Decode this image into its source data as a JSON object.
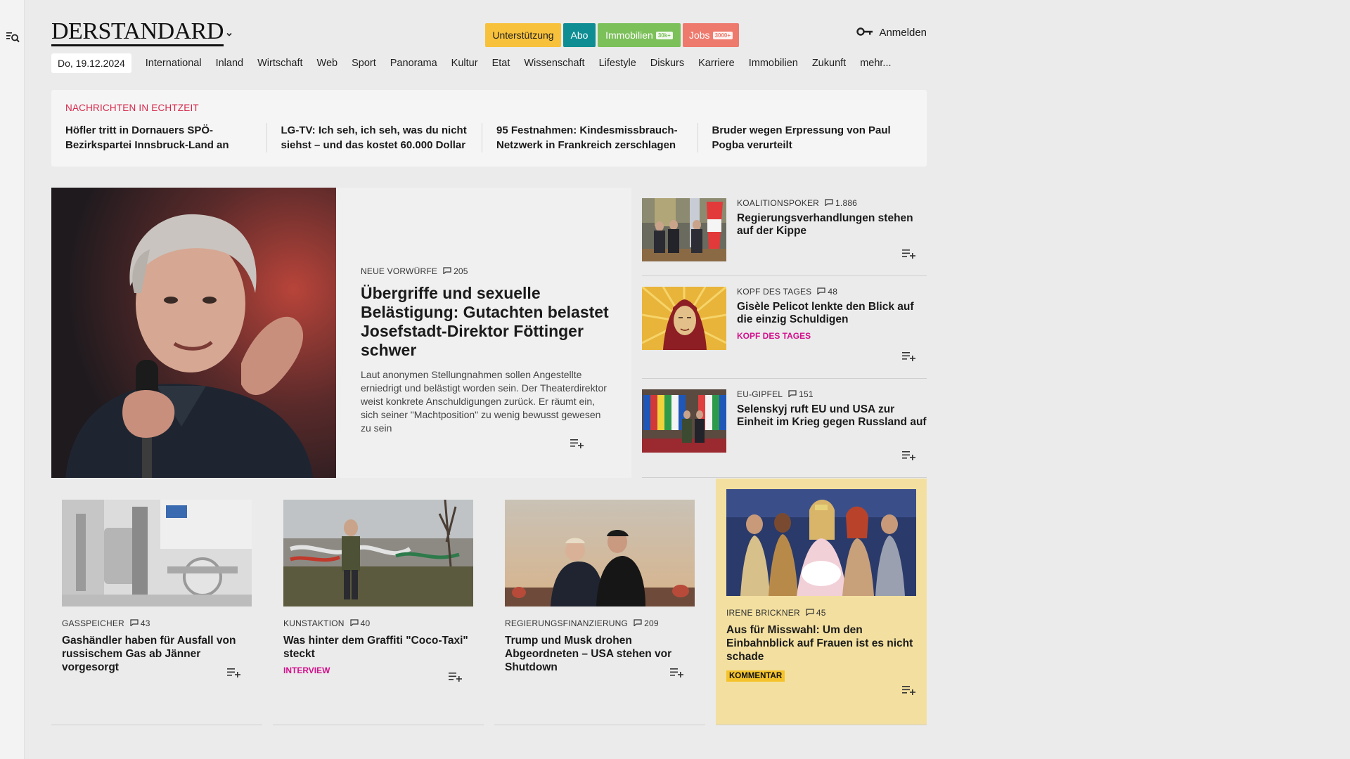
{
  "header": {
    "logo": "DERSTANDARD",
    "promos": {
      "unterstuetzung": "Unterstützung",
      "abo": "Abo",
      "immobilien": "Immobilien",
      "immobilien_badge": "30k+",
      "jobs": "Jobs",
      "jobs_badge": "3000+"
    },
    "login": "Anmelden"
  },
  "nav": {
    "date": "Do, 19.12.2024",
    "items": [
      "International",
      "Inland",
      "Wirtschaft",
      "Web",
      "Sport",
      "Panorama",
      "Kultur",
      "Etat",
      "Wissenschaft",
      "Lifestyle",
      "Diskurs",
      "Karriere",
      "Immobilien",
      "Zukunft",
      "mehr..."
    ]
  },
  "ticker": {
    "label": "Nachrichten in Echtzeit",
    "items": [
      "Höfler tritt in Dornauers SPÖ-Bezirks­partei Innsbruck-Land an",
      "LG-TV: Ich seh, ich seh, was du nicht siehst – und das kostet 60.000 Dollar",
      "95 Festnahmen: Kindesmissbrauch-Netzwerk in Frankreich zerschlagen",
      "Bruder wegen Erpressung von Paul Pogba verurteilt"
    ]
  },
  "hero": {
    "kicker": "Neue Vorwürfe",
    "comments": "205",
    "title": "Übergriffe und sexuelle Belästigung: Gutachten belastet Josefstadt-Direktor Föttinger schwer",
    "teaser": "Laut anonymen Stellungnahmen sollen Angestellte erniedrigt und belästigt worden sein. Der Theaterdi­rektor weist konkrete Anschuldigungen zurück. Er räumt ein, sich seiner \"Machtposition\" zu wenig bewusst gewesen zu sein"
  },
  "side": [
    {
      "kicker": "Koalitionspoker",
      "comments": "1.886",
      "title": "Regierungsverhandlungen stehen auf der Kippe",
      "tag": ""
    },
    {
      "kicker": "Kopf des Tages",
      "comments": "48",
      "title": "Gisèle Pelicot lenkte den Blick auf die einzig Schuldigen",
      "tag": "Kopf des Tages"
    },
    {
      "kicker": "EU-Gipfel",
      "comments": "151",
      "title": "Selenskyj ruft EU und USA zur Einheit im Krieg gegen Russland auf",
      "tag": ""
    }
  ],
  "cards": [
    {
      "kicker": "Gasspeicher",
      "comments": "43",
      "title": "Gashändler haben für Ausfall von russischem Gas ab Jänner vorgesorgt",
      "tag": ""
    },
    {
      "kicker": "Kunstaktion",
      "comments": "40",
      "title": "Was hinter dem Graffiti \"Coco-Taxi\" steckt",
      "tag": "Interview"
    },
    {
      "kicker": "Regierungsfinanzierung",
      "comments": "209",
      "title": "Trump und Musk drohen Abgeordneten – USA stehen vor Shutdown",
      "tag": ""
    },
    {
      "kicker": "Irene Brickner",
      "comments": "45",
      "title": "Aus für Misswahl: Um den Einbahnblick auf Frauen ist es nicht schade",
      "tag": "Kommentar"
    }
  ],
  "colors": {
    "breaking": "#d6294b",
    "tag_pink": "#d40f8c",
    "comment_bg": "#f3e0a0",
    "kommentar_badge": "#f4c32c"
  }
}
